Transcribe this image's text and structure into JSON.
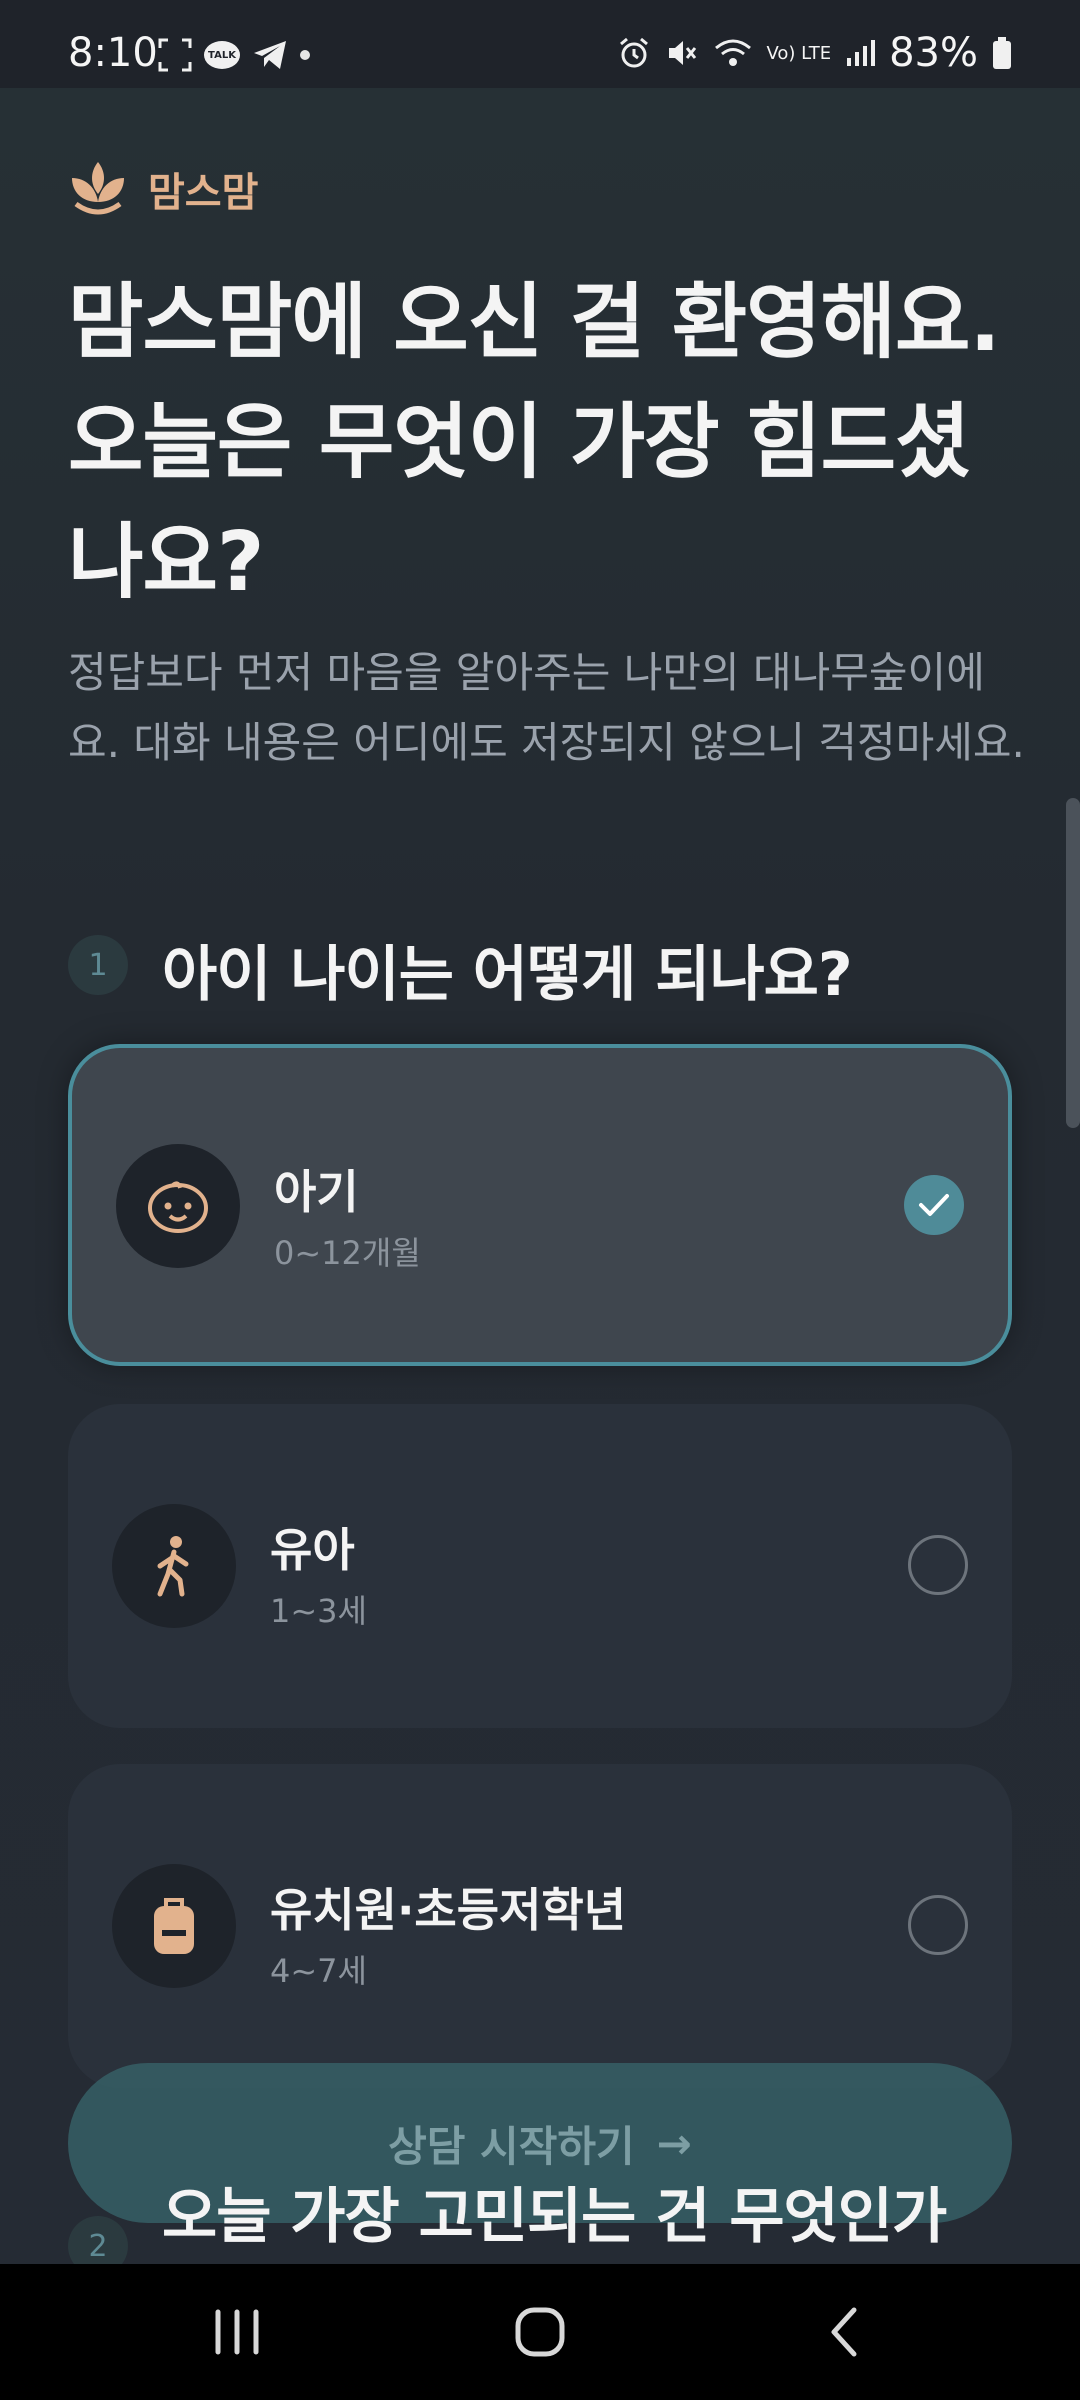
{
  "status_bar": {
    "time": "8:10",
    "talk_badge": "TALK",
    "lte": "Vo) LTE",
    "battery": "83%"
  },
  "brand": {
    "name": "맘스맘",
    "accent": "#e2b28d"
  },
  "headline": "맘스맘에 오신 걸 환영해요. 오늘은 무엇이 가장 힘드셨나요?",
  "subtitle": "정답보다 먼저 마음을 알아주는 나만의 대나무숲이에요. 대화 내용은 어디에도 저장되지 않으니 걱정마세요.",
  "step1": {
    "number": "1",
    "question": "아이 나이는 어떻게 되나요?",
    "options": [
      {
        "title": "아기",
        "subtitle": "0~12개월",
        "icon": "baby-face-icon",
        "selected": true
      },
      {
        "title": "유아",
        "subtitle": "1~3세",
        "icon": "walking-child-icon",
        "selected": false
      },
      {
        "title": "유치원·초등저학년",
        "subtitle": "4~7세",
        "icon": "backpack-icon",
        "selected": false
      }
    ]
  },
  "cta": {
    "label": "상담 시작하기",
    "arrow": "→"
  },
  "step2": {
    "number": "2",
    "question": "오늘 가장 고민되는 건 무엇인가"
  },
  "colors": {
    "selected_border": "#4a8e9c",
    "check_fill": "#4f8b98",
    "background": "#22272f"
  }
}
